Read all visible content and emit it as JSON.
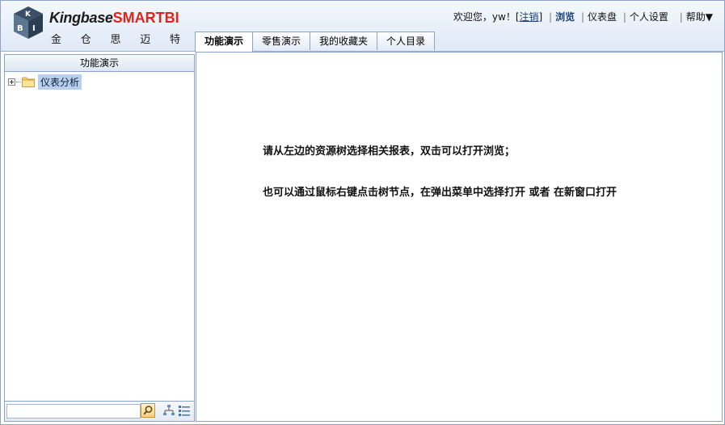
{
  "logo": {
    "brand_main": "Kingbase",
    "brand_accent": "SMART",
    "brand_suffix": "BI",
    "chinese_chars": [
      "金",
      "仓",
      "思",
      "迈",
      "特"
    ]
  },
  "topnav": {
    "welcome": "欢迎您，yw！[",
    "logout": "注销",
    "welcome_close": "]",
    "items": [
      "浏览",
      "仪表盘",
      "个人设置",
      "帮助▼"
    ]
  },
  "tabs": [
    "功能演示",
    "零售演示",
    "我的收藏夹",
    "个人目录"
  ],
  "left_panel": {
    "title": "功能演示",
    "tree": [
      {
        "label": "仪表分析",
        "icon": "folder-icon"
      }
    ],
    "search_placeholder": ""
  },
  "main": {
    "line1": "请从左边的资源树选择相关报表，双击可以打开浏览；",
    "line2": "也可以通过鼠标右键点击树节点，在弹出菜单中选择打开 或者 在新窗口打开"
  },
  "colors": {
    "border": "#8aa4c8",
    "header_bg": "#dfe9f6",
    "brand_accent": "#e0241b",
    "selection": "#b8cfee"
  }
}
